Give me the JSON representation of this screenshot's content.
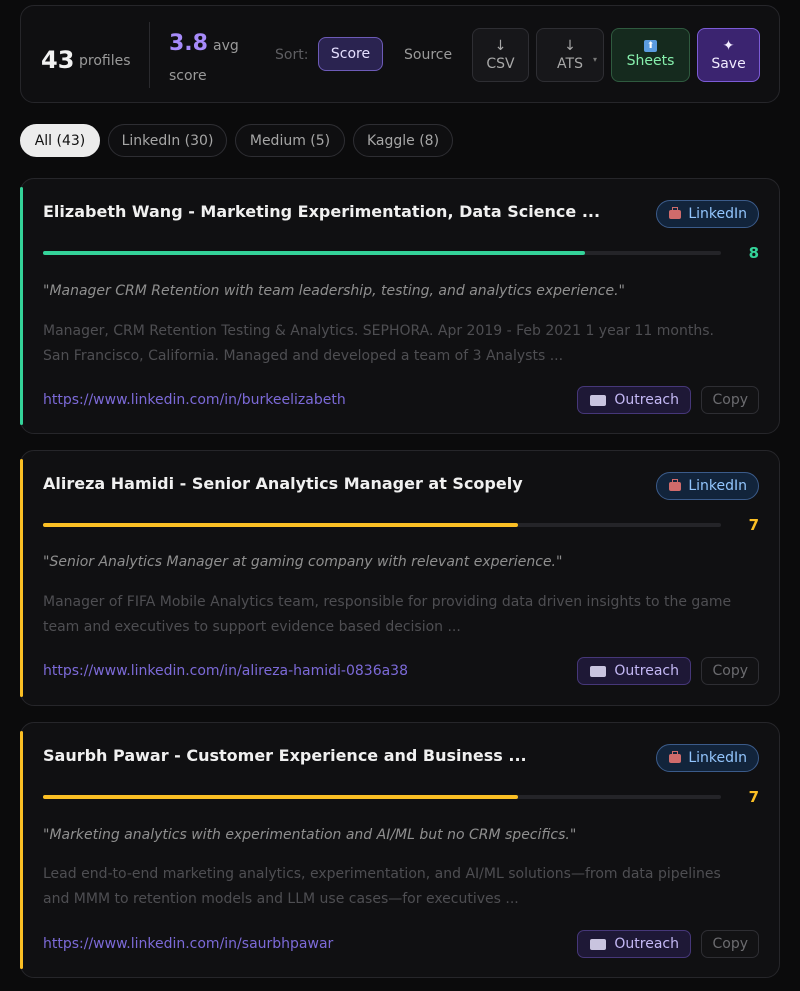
{
  "stats": {
    "profile_count": "43",
    "profile_label": "profiles",
    "avg_value": "3.8",
    "avg_word": "avg",
    "avg_score_word": "score"
  },
  "toolbar": {
    "sort_label": "Sort:",
    "sort_score": "Score",
    "source_label": "Source",
    "csv_icon": "↓",
    "csv_label": "CSV",
    "ats_icon": "↓",
    "ats_label": "ATS",
    "ats_caret": "▾",
    "sheets_label": "Sheets",
    "save_icon": "✦",
    "save_label": "Save"
  },
  "filters": [
    {
      "label": "All (43)",
      "active": true
    },
    {
      "label": "LinkedIn (30)",
      "active": false
    },
    {
      "label": "Medium (5)",
      "active": false
    },
    {
      "label": "Kaggle (8)",
      "active": false
    }
  ],
  "colors": {
    "score_high": "#34d399",
    "score_mid": "#fbbf24",
    "accent": "#a78bfa"
  },
  "cards": [
    {
      "title": "Elizabeth Wang - Marketing Experimentation, Data Science ...",
      "source": "LinkedIn",
      "score": "8",
      "score_fraction": 0.8,
      "quote": "\"Manager CRM Retention with team leadership, testing, and analytics experience.\"",
      "snippet": "Manager, CRM Retention Testing & Analytics. SEPHORA. Apr 2019 - Feb 2021 1 year 11 months. San Francisco, California. Managed and developed a team of 3 Analysts ...",
      "url": "https://www.linkedin.com/in/burkeelizabeth",
      "outreach_label": "Outreach",
      "copy_label": "Copy"
    },
    {
      "title": "Alireza Hamidi - Senior Analytics Manager at Scopely",
      "source": "LinkedIn",
      "score": "7",
      "score_fraction": 0.7,
      "quote": "\"Senior Analytics Manager at gaming company with relevant experience.\"",
      "snippet": "Manager of FIFA Mobile Analytics team, responsible for providing data driven insights to the game team and executives to support evidence based decision ...",
      "url": "https://www.linkedin.com/in/alireza-hamidi-0836a38",
      "outreach_label": "Outreach",
      "copy_label": "Copy"
    },
    {
      "title": "Saurbh Pawar - Customer Experience and Business ...",
      "source": "LinkedIn",
      "score": "7",
      "score_fraction": 0.7,
      "quote": "\"Marketing analytics with experimentation and AI/ML but no CRM specifics.\"",
      "snippet": "Lead end-to-end marketing analytics, experimentation, and AI/ML solutions—from data pipelines and MMM to retention models and LLM use cases—for executives ...",
      "url": "https://www.linkedin.com/in/saurbhpawar",
      "outreach_label": "Outreach",
      "copy_label": "Copy"
    }
  ]
}
